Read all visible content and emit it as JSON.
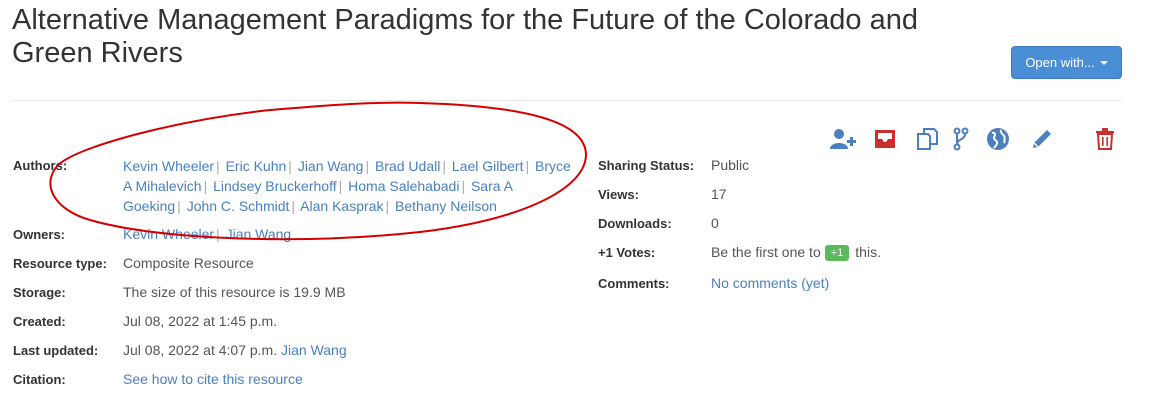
{
  "title": "Alternative Management Paradigms for the Future of the Colorado and Green Rivers",
  "open_with_button": "Open with...",
  "toolbar": {
    "icons": [
      "add-user-icon",
      "inbox-icon",
      "copy-icon",
      "fork-icon",
      "globe-icon",
      "edit-icon",
      "trash-icon"
    ],
    "primary_color": "#4a80c0",
    "danger_color": "#c9302c"
  },
  "labels": {
    "authors": "Authors:",
    "owners": "Owners:",
    "resource_type": "Resource type:",
    "storage": "Storage:",
    "created": "Created:",
    "last_updated": "Last updated:",
    "citation": "Citation:",
    "sharing_status": "Sharing Status:",
    "views": "Views:",
    "downloads": "Downloads:",
    "votes": "+1 Votes:",
    "comments": "Comments:"
  },
  "authors": [
    "Kevin Wheeler",
    "Eric Kuhn",
    "Jian Wang",
    "Brad Udall",
    "Lael Gilbert",
    "Bryce A Mihalevich",
    "Lindsey Bruckerhoff",
    "Homa Salehabadi",
    "Sara A Goeking",
    "John C. Schmidt",
    "Alan Kasprak",
    "Bethany Neilson"
  ],
  "owners": [
    "Kevin Wheeler",
    "Jian Wang"
  ],
  "resource_type": "Composite Resource",
  "storage": "The size of this resource is 19.9 MB",
  "created": "Jul 08, 2022 at 1:45 p.m.",
  "last_updated": "Jul 08, 2022 at 4:07 p.m.",
  "last_updated_by": "Jian Wang",
  "citation_link": "See how to cite this resource",
  "sharing_status": "Public",
  "views": "17",
  "downloads": "0",
  "votes_prefix": "Be the first one to",
  "vote_button": "+1",
  "votes_suffix": "this.",
  "comments_link": "No comments (yet)",
  "annotation_color": "#d40000"
}
